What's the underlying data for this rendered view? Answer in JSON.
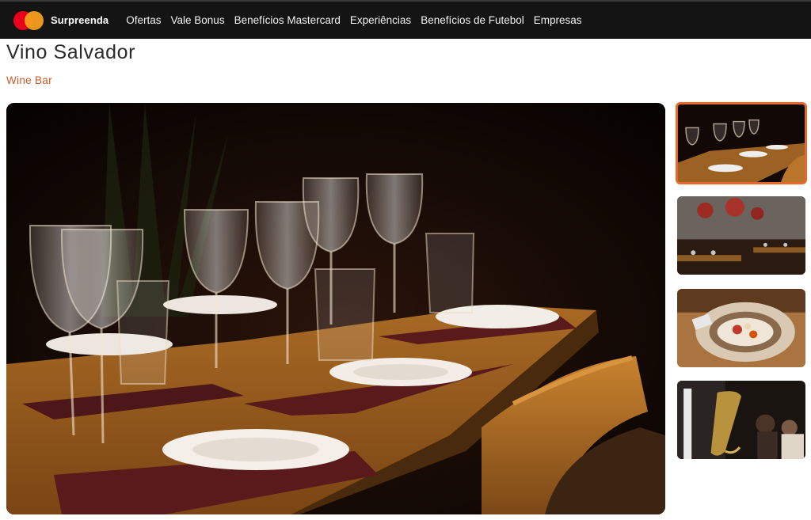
{
  "header": {
    "brand": "Surpreenda",
    "nav": [
      "Ofertas",
      "Vale Bonus",
      "Benefícios Mastercard",
      "Experiências",
      "Benefícios de Futebol",
      "Empresas"
    ]
  },
  "venue": {
    "name": "Vino Salvador",
    "category": "Wine Bar"
  },
  "colors": {
    "accent": "#cf5a26",
    "header_bg": "#141414",
    "thumb_border": "#e8682d"
  }
}
